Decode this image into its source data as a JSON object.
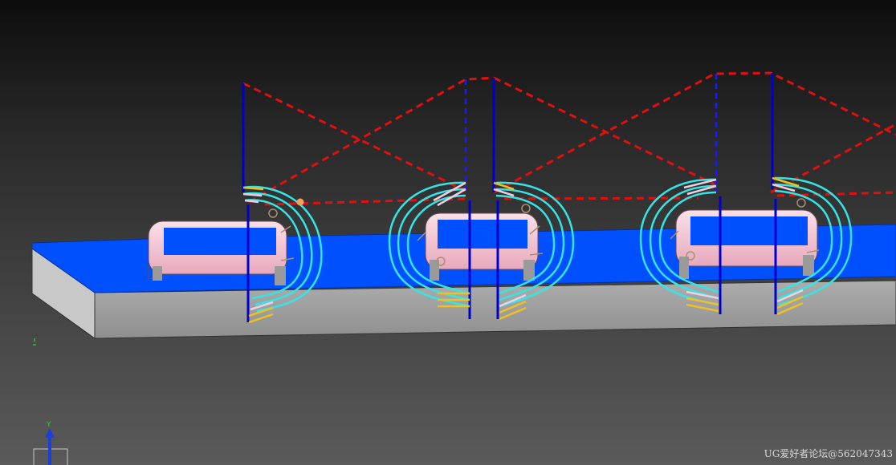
{
  "watermark": {
    "text": "UG爱好者论坛@562047343"
  },
  "triad": {
    "axis_label": "Y"
  },
  "colors": {
    "background_top": "#0d0d0d",
    "background_bottom": "#5a5a5a",
    "floor_face": "#0050ff",
    "side_face": "#a6a6a6",
    "boss": "#f6c6d4",
    "rapid_move": "#e01010",
    "engage_line": "#0000cc",
    "toolpath_cut": "#33e6e6",
    "toolpath_entry": "#f0c020",
    "toolpath_exit": "#f0d0e0"
  },
  "icons": [
    "coordinate-triad-icon",
    "selection-point-icon"
  ]
}
